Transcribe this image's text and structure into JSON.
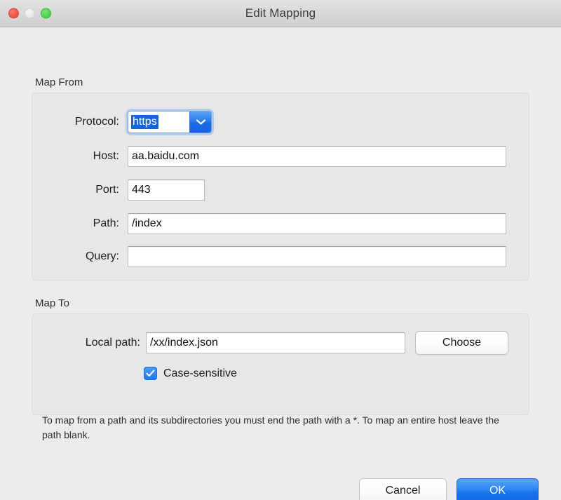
{
  "window": {
    "title": "Edit Mapping",
    "controls": {
      "close": "close-button",
      "minimize": "minimize-button",
      "maximize": "maximize-button"
    },
    "accent_color": "#1a74ec",
    "background_color": "#ececec"
  },
  "map_from": {
    "group_label": "Map From",
    "fields": [
      {
        "label": "Protocol:",
        "value": "https",
        "type": "combobox",
        "selected": true
      },
      {
        "label": "Host:",
        "value": "aa.baidu.com",
        "type": "text"
      },
      {
        "label": "Port:",
        "value": "443",
        "type": "text"
      },
      {
        "label": "Path:",
        "value": "/index",
        "type": "text"
      },
      {
        "label": "Query:",
        "value": "",
        "type": "text"
      }
    ]
  },
  "map_to": {
    "group_label": "Map To",
    "local_path": {
      "label": "Local path:",
      "value": "/xx/index.json"
    },
    "choose_button": "Choose",
    "case_sensitive": {
      "label": "Case-sensitive",
      "checked": true
    }
  },
  "help_text": "To map from a path and its subdirectories you must end the path with a *. To map an entire host leave the path blank.",
  "footer": {
    "cancel_label": "Cancel",
    "ok_label": "OK"
  }
}
